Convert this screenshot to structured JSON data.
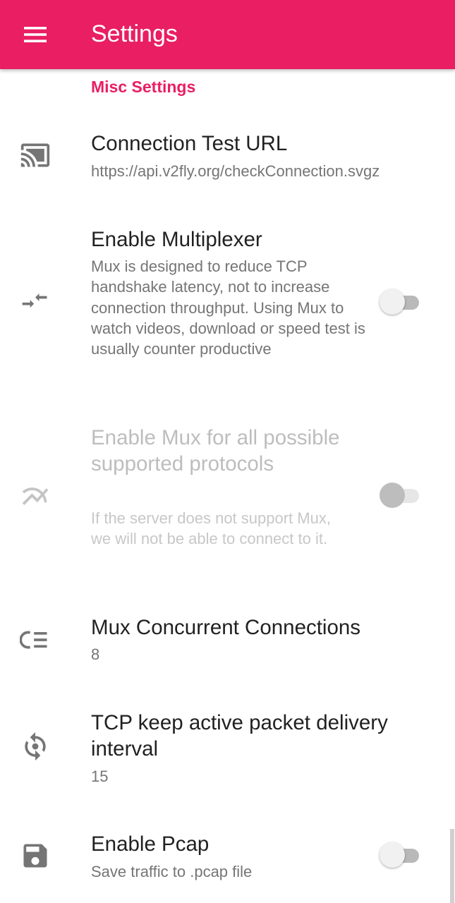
{
  "appbar": {
    "title": "Settings",
    "menu_icon": "hamburger-menu-icon",
    "color": "#e91e63"
  },
  "category": {
    "label": "Misc Settings"
  },
  "prefs": [
    {
      "title": "Connection Test URL",
      "summary": "https://api.v2fly.org/checkConnection.svgz",
      "icon": "cast-icon"
    },
    {
      "title": "Enable Multiplexer",
      "summary": "Mux is designed to reduce TCP handshake latency, not to increase connection throughput. Using Mux to watch videos, download or speed test is usually counter productive",
      "icon": "compress-arrows-icon",
      "switch_on": false
    },
    {
      "title": "Enable Mux for all possible supported protocols",
      "summary": "If the server does not support Mux, we will not be able to connect to it.",
      "icon": "multiline-chart-icon",
      "switch_on": false,
      "disabled": true
    },
    {
      "title": "Mux Concurrent Connections",
      "summary": "8",
      "icon": "playlist-list-icon"
    },
    {
      "title": "TCP keep active packet delivery interval",
      "summary": "15",
      "icon": "sync-refresh-icon"
    },
    {
      "title": "Enable Pcap",
      "summary": "Save traffic to .pcap file",
      "icon": "save-floppy-icon",
      "switch_on": false
    }
  ]
}
